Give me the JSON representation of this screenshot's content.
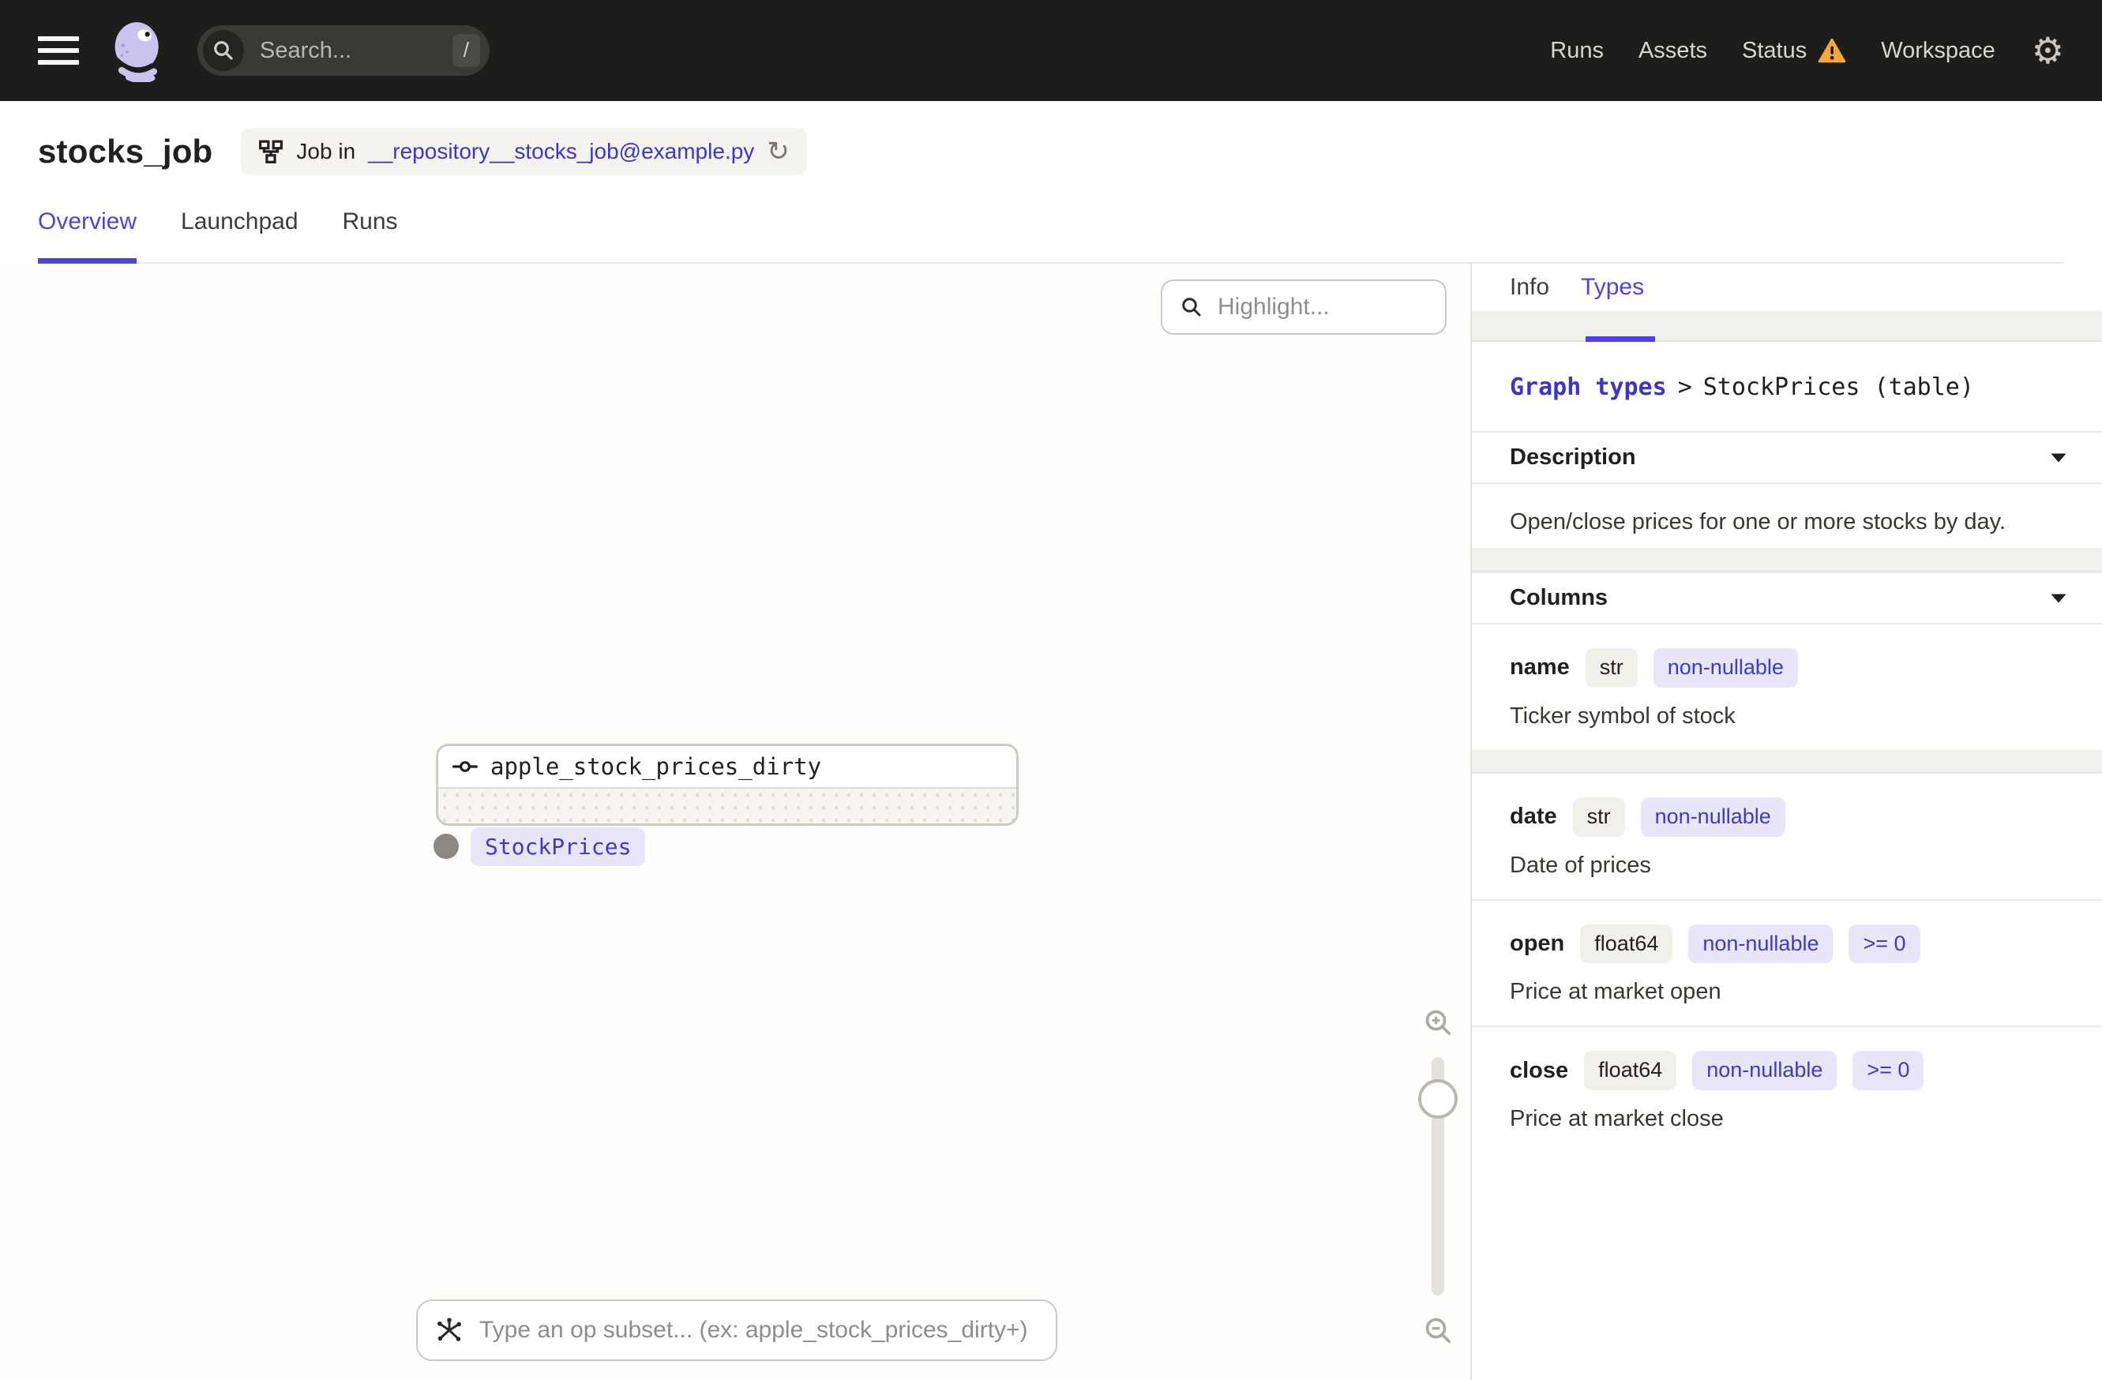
{
  "topnav": {
    "search": {
      "placeholder": "Search...",
      "shortcut": "/"
    },
    "links": [
      {
        "label": "Runs"
      },
      {
        "label": "Assets"
      },
      {
        "label": "Status"
      },
      {
        "label": "Workspace"
      }
    ],
    "icons": {
      "gear_glyph": "⚙"
    }
  },
  "header": {
    "title": "stocks_job",
    "badge": {
      "prefix": "Job in",
      "link": "__repository__stocks_job@example.py",
      "reload_glyph": "↻"
    }
  },
  "tabs": [
    {
      "label": "Overview"
    },
    {
      "label": "Launchpad"
    },
    {
      "label": "Runs"
    }
  ],
  "canvas": {
    "highlight_placeholder": "Highlight...",
    "node": {
      "name": "apple_stock_prices_dirty",
      "output_type": "StockPrices"
    },
    "op_subset_placeholder": "Type an op subset... (ex: apple_stock_prices_dirty+)"
  },
  "panel": {
    "tabs": [
      {
        "label": "Info"
      },
      {
        "label": "Types"
      }
    ],
    "breadcrumb": {
      "link": "Graph types",
      "separator": ">",
      "current": "StockPrices (table)"
    },
    "description": {
      "title": "Description",
      "text": "Open/close prices for one or more stocks by day."
    },
    "columns": {
      "title": "Columns",
      "rows": [
        {
          "name": "name",
          "tags": [
            "str",
            "non-nullable"
          ],
          "description": "Ticker symbol of stock"
        },
        {
          "name": "date",
          "tags": [
            "str",
            "non-nullable"
          ],
          "description": "Date of prices"
        },
        {
          "name": "open",
          "tags": [
            "float64",
            "non-nullable",
            ">= 0"
          ],
          "description": "Price at market open"
        },
        {
          "name": "close",
          "tags": [
            "float64",
            "non-nullable",
            ">= 0"
          ],
          "description": "Price at market close"
        }
      ]
    }
  },
  "colors": {
    "accent": "#4F43DD",
    "link": "#3D36C4",
    "warning": "#F2A93C",
    "nav_bg": "#1F1D1B",
    "tag_beige_bg": "#F2F0EA",
    "tag_lavender_bg": "#E8E6F8"
  }
}
